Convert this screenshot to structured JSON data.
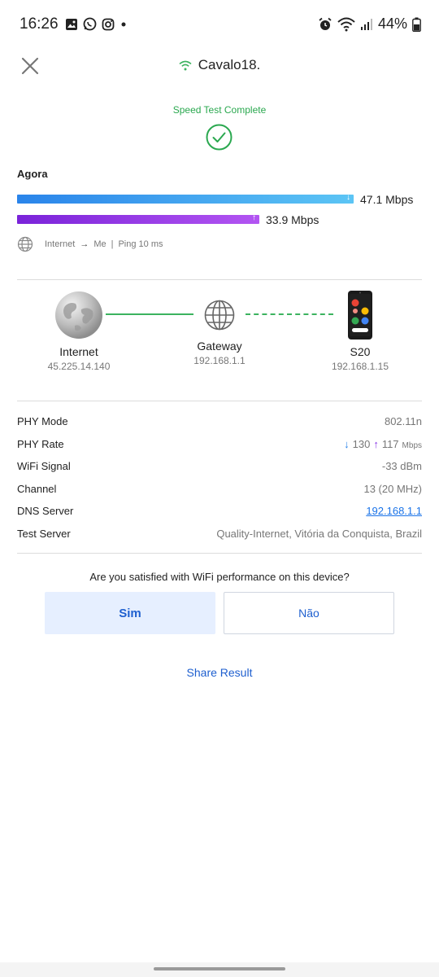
{
  "status_bar": {
    "time": "16:26",
    "battery": "44%",
    "left_icons": [
      "gallery-icon",
      "whatsapp-icon",
      "instagram-icon",
      "dot-icon"
    ],
    "right_icons": [
      "alarm-icon",
      "wifi-icon",
      "signal-icon",
      "battery-icon"
    ]
  },
  "header": {
    "network_name": "Cavalo18.",
    "status": "Speed Test Complete"
  },
  "speed": {
    "section_label": "Agora",
    "download": "47.1 Mbps",
    "download_fraction": 1.0,
    "upload": "33.9 Mbps",
    "upload_fraction": 0.72,
    "route_from": "Internet",
    "route_to": "Me",
    "separator": "|",
    "ping": "Ping 10 ms"
  },
  "topology": {
    "internet": {
      "name": "Internet",
      "ip": "45.225.14.140"
    },
    "gateway": {
      "name": "Gateway",
      "ip": "192.168.1.1"
    },
    "device": {
      "name": "S20",
      "ip": "192.168.1.15"
    }
  },
  "details": {
    "phy_mode": {
      "label": "PHY Mode",
      "value": "802.11n"
    },
    "phy_rate": {
      "label": "PHY Rate",
      "down": "130",
      "up": "117",
      "unit": "Mbps"
    },
    "wifi_signal": {
      "label": "WiFi Signal",
      "value": "-33 dBm"
    },
    "channel": {
      "label": "Channel",
      "value": "13 (20 MHz)"
    },
    "dns_server": {
      "label": "DNS Server",
      "value": "192.168.1.1"
    },
    "test_server": {
      "label": "Test Server",
      "value": "Quality-Internet, Vitória da Conquista, Brazil"
    }
  },
  "feedback": {
    "question": "Are you satisfied with WiFi performance on this device?",
    "yes_label": "Sim",
    "no_label": "Não"
  },
  "share_label": "Share Result",
  "colors": {
    "success_green": "#2aa84f",
    "download_blue": "#2a84ea",
    "upload_purple": "#7a23d9",
    "link_blue": "#1e5fcf"
  }
}
